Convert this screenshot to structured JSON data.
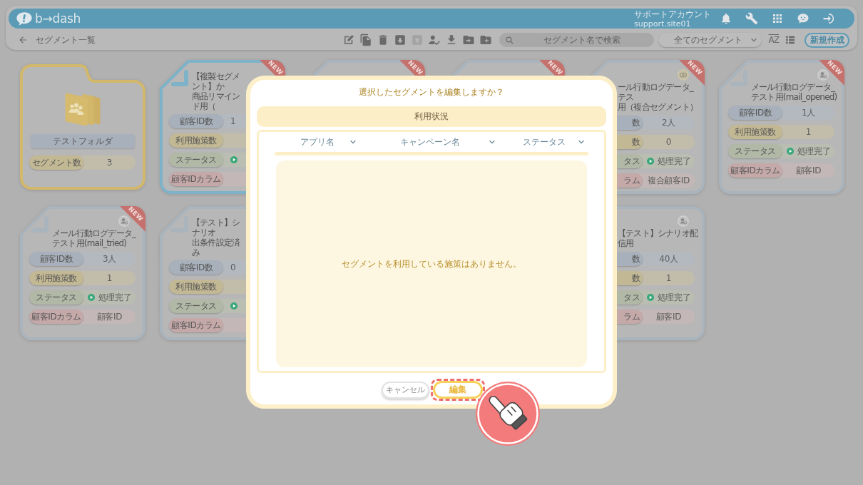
{
  "header": {
    "logo": "b→dash",
    "account_name": "サポートアカウント",
    "account_id": "support.site01"
  },
  "toolbar": {
    "title": "セグメント一覧",
    "tools": [
      {
        "kind": "edit",
        "disabled": false
      },
      {
        "kind": "copy",
        "disabled": false
      },
      {
        "kind": "delete",
        "disabled": false
      },
      {
        "kind": "archive",
        "disabled": false
      },
      {
        "kind": "unarchive",
        "disabled": true
      },
      {
        "kind": "assign",
        "disabled": false
      },
      {
        "kind": "download",
        "disabled": false
      },
      {
        "kind": "move",
        "disabled": false
      },
      {
        "kind": "add_folder",
        "disabled": false
      }
    ],
    "search": {
      "placeholder": "セグメント名で検索"
    },
    "filter": {
      "value": "全てのセグメント"
    },
    "sort_button": "AZ",
    "new_button": "新規作成"
  },
  "cards": [
    {
      "kind": "folder",
      "selected": false,
      "name": "テストフォルダ",
      "stats": [
        {
          "kind": "text",
          "label": "セグメント数",
          "value": "3"
        }
      ]
    },
    {
      "kind": "segment",
      "selected": true,
      "badge": "NEW",
      "title_lines": [
        "【複製セグメント】か",
        "商品リマインド用（"
      ],
      "stats": [
        {
          "kind": "text",
          "label": "顧客ID数",
          "value": "1"
        },
        {
          "kind": "text",
          "label": "利用施策数"
        },
        {
          "kind": "status",
          "label": "ステータス"
        },
        {
          "kind": "text",
          "label": "顧客IDカラム"
        }
      ]
    },
    {
      "kind": "segment",
      "selected": false,
      "badge": "NEW"
    },
    {
      "kind": "segment",
      "selected": false,
      "badge": "NEW"
    },
    {
      "kind": "composite",
      "selected": false,
      "badge": "NEW",
      "title_lines": [
        "ール行動ログデータ_テス",
        "用（複合セグメント）"
      ],
      "stats": [
        {
          "kind": "text",
          "label": "数",
          "value": "2人"
        },
        {
          "kind": "text",
          "label": "数",
          "value": "0"
        },
        {
          "kind": "status",
          "label": "タス",
          "value": "処理完了"
        },
        {
          "kind": "text",
          "label": "ラム",
          "value": "複合顧客ID"
        }
      ]
    },
    {
      "kind": "segment",
      "selected": false,
      "badge": "NEW",
      "title_lines": [
        "メール行動ログデータ_テスト用(mail_opened)"
      ],
      "stats": [
        {
          "kind": "text",
          "label": "顧客ID数",
          "value": "1人"
        },
        {
          "kind": "text",
          "label": "利用施策数",
          "value": "1"
        },
        {
          "kind": "status",
          "label": "ステータス",
          "value": "処理完了"
        },
        {
          "kind": "text",
          "label": "顧客IDカラム",
          "value": "顧客ID"
        }
      ]
    },
    {
      "kind": "segment",
      "selected": false,
      "badge": "NEW",
      "title_lines": [
        "メール行動ログデータ_テスト用(mail_tried)"
      ],
      "stats": [
        {
          "kind": "text",
          "label": "顧客ID数",
          "value": "3人"
        },
        {
          "kind": "text",
          "label": "利用施策数",
          "value": "1"
        },
        {
          "kind": "status",
          "label": "ステータス",
          "value": "処理完了"
        },
        {
          "kind": "text",
          "label": "顧客IDカラム",
          "value": "顧客ID"
        }
      ]
    },
    {
      "kind": "segment",
      "selected": false,
      "title_lines": [
        "【テスト】シナリオ",
        "出条件設定済み"
      ],
      "stats": [
        {
          "kind": "text",
          "label": "顧客ID数",
          "value": "0"
        },
        {
          "kind": "text",
          "label": "利用施策数"
        },
        {
          "kind": "status",
          "label": "ステータス"
        },
        {
          "kind": "text",
          "label": "顧客IDカラム"
        }
      ]
    },
    {
      "kind": "segment",
      "selected": false,
      "title_lines": [
        "【テスト】シナリオ配信用"
      ],
      "stats": [
        {
          "kind": "text",
          "label": "数",
          "value": "40人"
        },
        {
          "kind": "text",
          "label": "数",
          "value": "1"
        },
        {
          "kind": "status",
          "label": "タス",
          "value": "処理完了"
        },
        {
          "kind": "text",
          "label": "ラム",
          "value": "顧客ID"
        }
      ]
    }
  ],
  "dialog": {
    "question": "選択したセグメントを編集しますか？",
    "section_title": "利用状況",
    "columns": [
      "アプリ名",
      "キャンペーン名",
      "ステータス"
    ],
    "empty_message": "セグメントを利用している施策はありません。",
    "buttons": [
      {
        "kind": "cancel",
        "label": "キャンセル",
        "highlighted": false
      },
      {
        "kind": "primary",
        "label": "編集",
        "highlighted": true
      }
    ]
  }
}
